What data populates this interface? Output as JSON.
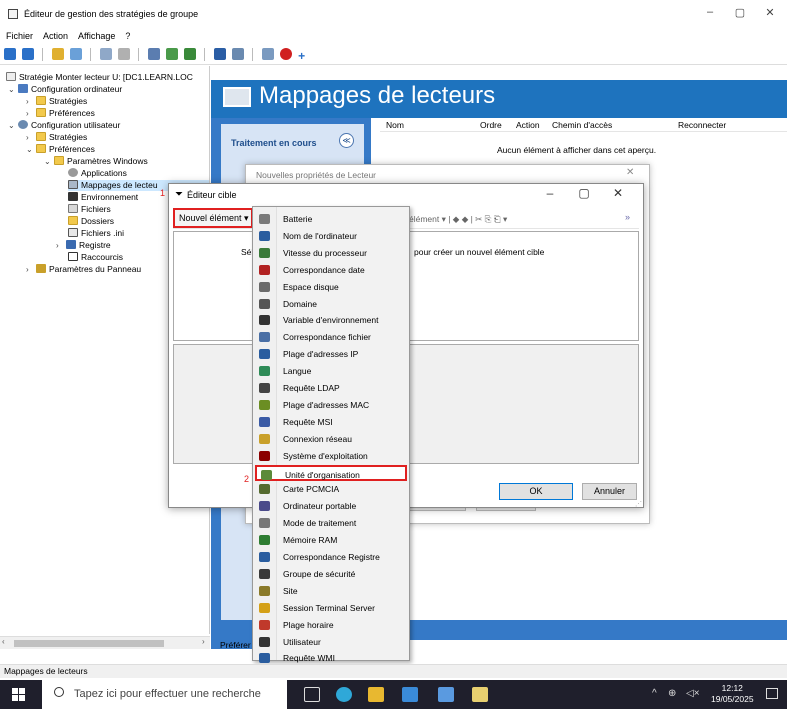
{
  "window": {
    "title": "Éditeur de gestion des stratégies de groupe",
    "controls": {
      "minimize": "–",
      "maximize": "▢",
      "close": "✕"
    }
  },
  "menubar": [
    "Fichier",
    "Action",
    "Affichage",
    "?"
  ],
  "tree": {
    "root": "Stratégie Monter lecteur U: [DC1.LEARN.LOC",
    "computer_config": "Configuration ordinateur",
    "cc_strategies": "Stratégies",
    "cc_preferences": "Préférences",
    "user_config": "Configuration utilisateur",
    "uc_strategies": "Stratégies",
    "uc_preferences": "Préférences",
    "windows_params": "Paramètres Windows",
    "applications": "Applications",
    "drive_maps": "Mappages de lecteu",
    "environment": "Environnement",
    "files": "Fichiers",
    "folders": "Dossiers",
    "ini_files": "Fichiers .ini",
    "registry": "Registre",
    "shortcuts": "Raccourcis",
    "panel_params": "Paramètres du Panneau"
  },
  "right": {
    "banner_title": "Mappages de lecteurs",
    "processing_label": "Traitement en cours",
    "columns": [
      "Nom",
      "Ordre",
      "Action",
      "Chemin d'accès",
      "Reconnecter"
    ],
    "empty_message": "Aucun élément à afficher dans cet aperçu.",
    "bottom_tab": "Préférer"
  },
  "back_dialog": {
    "title": "Nouvelles propriétés de Lecteur",
    "close": "✕"
  },
  "dialog": {
    "title": "Éditeur cible",
    "new_item_button": "Nouvel élément ▾",
    "toolbar_text": "élément ▾  |  ◆  ◆  |  ✂  ⎘  ⎗ ▾",
    "more": "»",
    "hint_left": "Sél",
    "hint": "pour créer un nouvel élément cible",
    "ok": "OK",
    "cancel": "Annuler",
    "annotation_1": "1",
    "annotation_2": "2"
  },
  "menu_items": [
    {
      "label": "Batterie",
      "icon": "battery-icon",
      "color": "#7a7a7a"
    },
    {
      "label": "Nom de l'ordinateur",
      "icon": "computer-icon",
      "color": "#2a5d9f"
    },
    {
      "label": "Vitesse du processeur",
      "icon": "cpu-icon",
      "color": "#3a7a3a"
    },
    {
      "label": "Correspondance date",
      "icon": "calendar-icon",
      "color": "#b22222"
    },
    {
      "label": "Espace disque",
      "icon": "disk-icon",
      "color": "#6a6a6a"
    },
    {
      "label": "Domaine",
      "icon": "domain-icon",
      "color": "#555555"
    },
    {
      "label": "Variable d'environnement",
      "icon": "env-variable-icon",
      "color": "#333333"
    },
    {
      "label": "Correspondance fichier",
      "icon": "file-match-icon",
      "color": "#4a6fa5"
    },
    {
      "label": "Plage d'adresses IP",
      "icon": "ip-range-icon",
      "color": "#2a5d9f"
    },
    {
      "label": "Langue",
      "icon": "globe-icon",
      "color": "#2e8b57"
    },
    {
      "label": "Requête LDAP",
      "icon": "ldap-icon",
      "color": "#444444"
    },
    {
      "label": "Plage d'adresses MAC",
      "icon": "mac-range-icon",
      "color": "#6b8e23"
    },
    {
      "label": "Requête MSI",
      "icon": "msi-icon",
      "color": "#3b5ba5"
    },
    {
      "label": "Connexion réseau",
      "icon": "network-icon",
      "color": "#c9a02a"
    },
    {
      "label": "Système d'exploitation",
      "icon": "os-icon",
      "color": "#8b0000"
    },
    {
      "label": "Unité d'organisation",
      "icon": "ou-icon",
      "color": "#5c8a3a"
    },
    {
      "label": "Carte PCMCIA",
      "icon": "pcmcia-icon",
      "color": "#556b2f"
    },
    {
      "label": "Ordinateur portable",
      "icon": "laptop-icon",
      "color": "#4a4a8a"
    },
    {
      "label": "Mode de traitement",
      "icon": "processing-mode-icon",
      "color": "#777777"
    },
    {
      "label": "Mémoire RAM",
      "icon": "ram-icon",
      "color": "#2e7d32"
    },
    {
      "label": "Correspondance Registre",
      "icon": "registry-icon",
      "color": "#2a5d9f"
    },
    {
      "label": "Groupe de sécurité",
      "icon": "security-group-icon",
      "color": "#3a3a3a"
    },
    {
      "label": "Site",
      "icon": "site-icon",
      "color": "#8a7a2a"
    },
    {
      "label": "Session Terminal Server",
      "icon": "terminal-server-icon",
      "color": "#d4a017"
    },
    {
      "label": "Plage horaire",
      "icon": "clock-icon",
      "color": "#c0392b"
    },
    {
      "label": "Utilisateur",
      "icon": "user-icon",
      "color": "#333333"
    },
    {
      "label": "Requête WMI",
      "icon": "wmi-icon",
      "color": "#2a5d9f"
    }
  ],
  "statusbar": "Mappages de lecteurs",
  "taskbar": {
    "search_placeholder": "Tapez ici pour effectuer une recherche",
    "time": "12:12",
    "date": "19/05/2025"
  },
  "colors": {
    "accent": "#1e73be",
    "highlight": "#e02020",
    "taskbar": "#1f1f2c"
  }
}
